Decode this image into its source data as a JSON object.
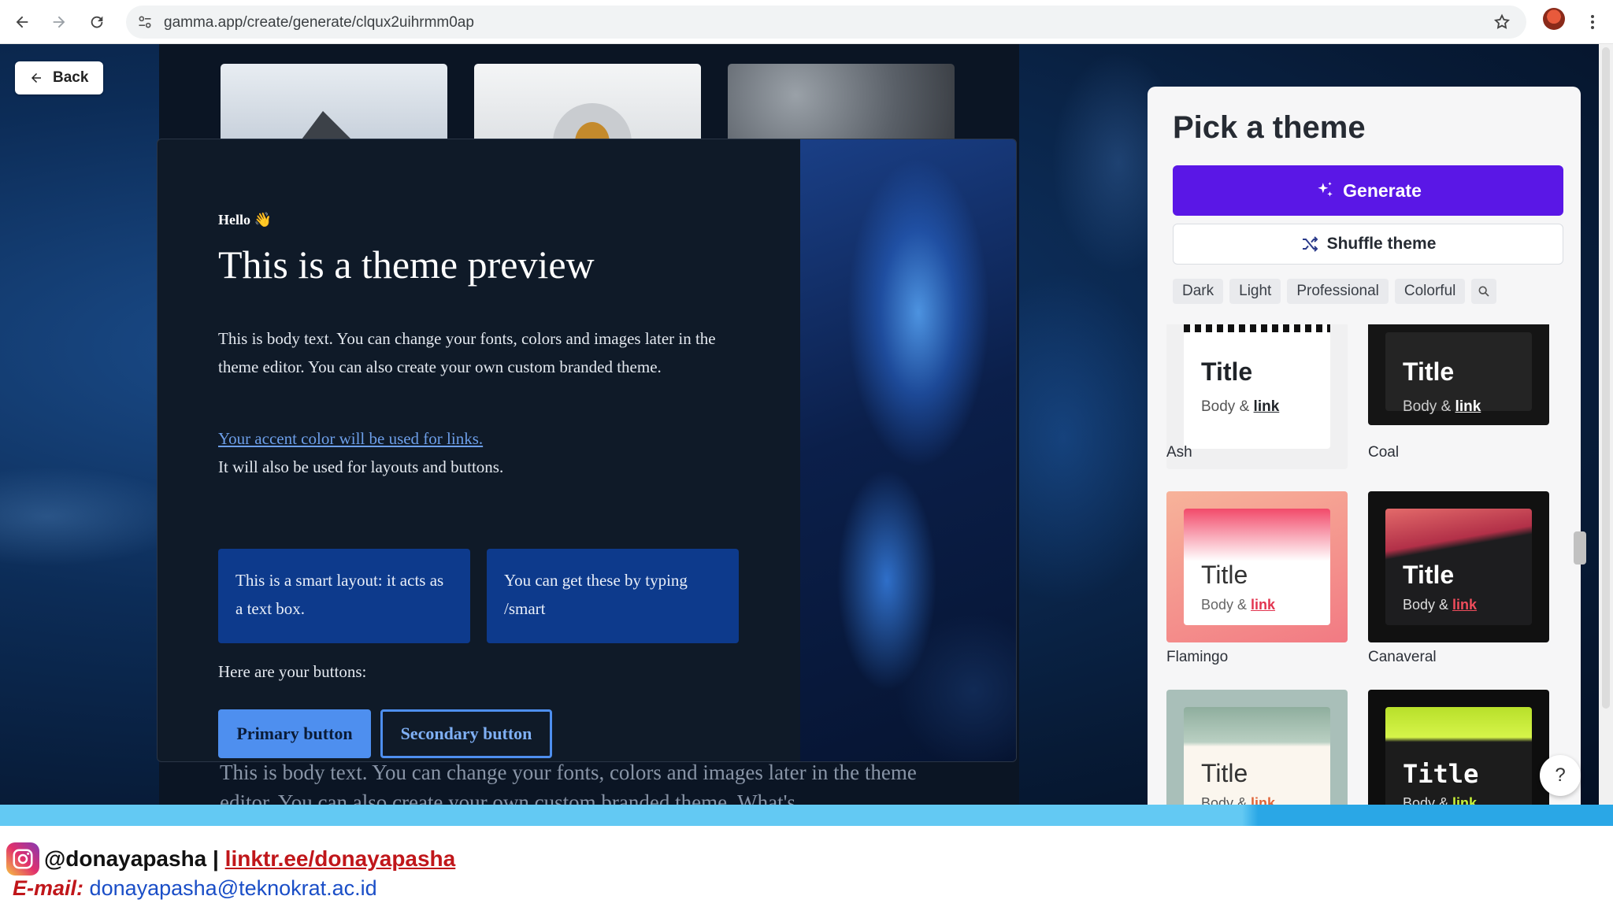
{
  "browser": {
    "url": "gamma.app/create/generate/clqux2uihrmm0ap"
  },
  "app": {
    "back_label": "Back"
  },
  "preview": {
    "hello": "Hello 👋",
    "title": "This is a theme preview",
    "body": "This is body text. You can change your fonts, colors and images later in the theme editor. You can also create your own custom branded theme.",
    "accent_link": "Your accent color will be used for links.",
    "accent_note": "It will also be used for layouts and buttons.",
    "smart_box_1": "This is a smart layout: it acts as a text box.",
    "smart_box_2": "You can get these by typing /smart",
    "buttons_label": "Here are your buttons:",
    "primary_button": "Primary button",
    "secondary_button": "Secondary button",
    "behind_text": "This is body text. You can change your fonts, colors and images later in the theme editor. You can also create your own custom branded theme. What's"
  },
  "panel": {
    "title": "Pick a theme",
    "generate_label": "Generate",
    "shuffle_label": "Shuffle theme",
    "filters": [
      "Dark",
      "Light",
      "Professional",
      "Colorful"
    ],
    "themes": [
      {
        "name": "Ash",
        "title": "Title",
        "body": "Body & ",
        "link": "link",
        "link_color": "#1f2328"
      },
      {
        "name": "Coal",
        "title": "Title",
        "body": "Body & ",
        "link": "link",
        "link_color": "#ffffff"
      },
      {
        "name": "Flamingo",
        "title": "Title",
        "body": "Body & ",
        "link": "link",
        "link_color": "#e2344f"
      },
      {
        "name": "Canaveral",
        "title": "Title",
        "body": "Body & ",
        "link": "link",
        "link_color": "#ef4d5c"
      },
      {
        "name": "",
        "title": "Title",
        "body": "Body & ",
        "link": "link",
        "link_color": "#e0653a"
      },
      {
        "name": "",
        "title": "Title",
        "body": "Body & ",
        "link": "link",
        "link_color": "#c8f23a"
      }
    ]
  },
  "overlay": {
    "handle": "@donayapasha",
    "separator": " | ",
    "linktree": "linktr.ee/donayapasha",
    "email_label": "E-mail:",
    "email": "donayapasha@teknokrat.ac.id"
  },
  "colors": {
    "generate_bg": "#5a17e6",
    "accent": "#4e8fef",
    "smart_box": "#0d3a8c"
  }
}
